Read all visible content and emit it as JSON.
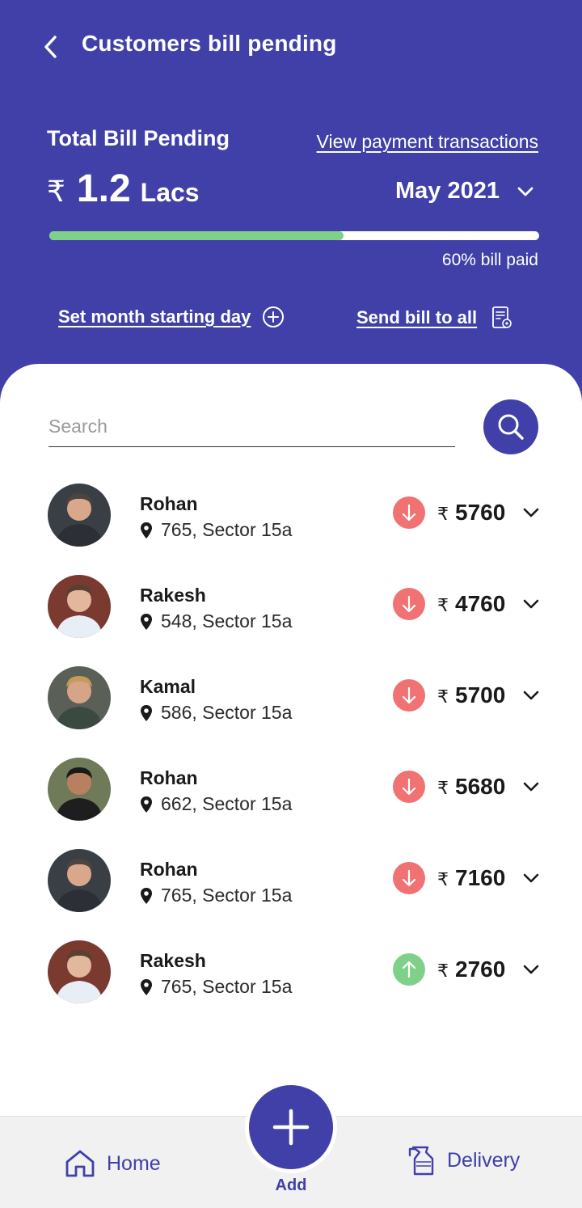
{
  "header": {
    "title": "Customers bill pending",
    "total_label": "Total Bill Pending",
    "view_link": "View payment transactions",
    "currency_symbol": "₹",
    "amount": "1.2",
    "amount_unit": "Lacs",
    "month": "May 2021",
    "paid_fraction": 0.6,
    "paid_text": "60% bill paid",
    "set_month_label": "Set month starting day",
    "send_bill_label": "Send bill to all"
  },
  "search": {
    "placeholder": "Search"
  },
  "customers": [
    {
      "name": "Rohan",
      "address": "765, Sector 15a",
      "trend": "down",
      "amount": "5760"
    },
    {
      "name": "Rakesh",
      "address": "548, Sector 15a",
      "trend": "down",
      "amount": "4760"
    },
    {
      "name": "Kamal",
      "address": "586, Sector 15a",
      "trend": "down",
      "amount": "5700"
    },
    {
      "name": "Rohan",
      "address": "662, Sector 15a",
      "trend": "down",
      "amount": "5680"
    },
    {
      "name": "Rohan",
      "address": "765, Sector 15a",
      "trend": "down",
      "amount": "7160"
    },
    {
      "name": "Rakesh",
      "address": "765, Sector 15a",
      "trend": "up",
      "amount": "2760"
    }
  ],
  "bottom_nav": {
    "home_label": "Home",
    "add_label": "Add",
    "delivery_label": "Delivery"
  },
  "icons": {
    "trend_down": "arrow-down-icon",
    "trend_up": "arrow-up-icon"
  },
  "colors": {
    "primary": "#4040a8",
    "progress_fill": "#7fd18a",
    "trend_down": "#f07272",
    "trend_up": "#7fd18a"
  }
}
